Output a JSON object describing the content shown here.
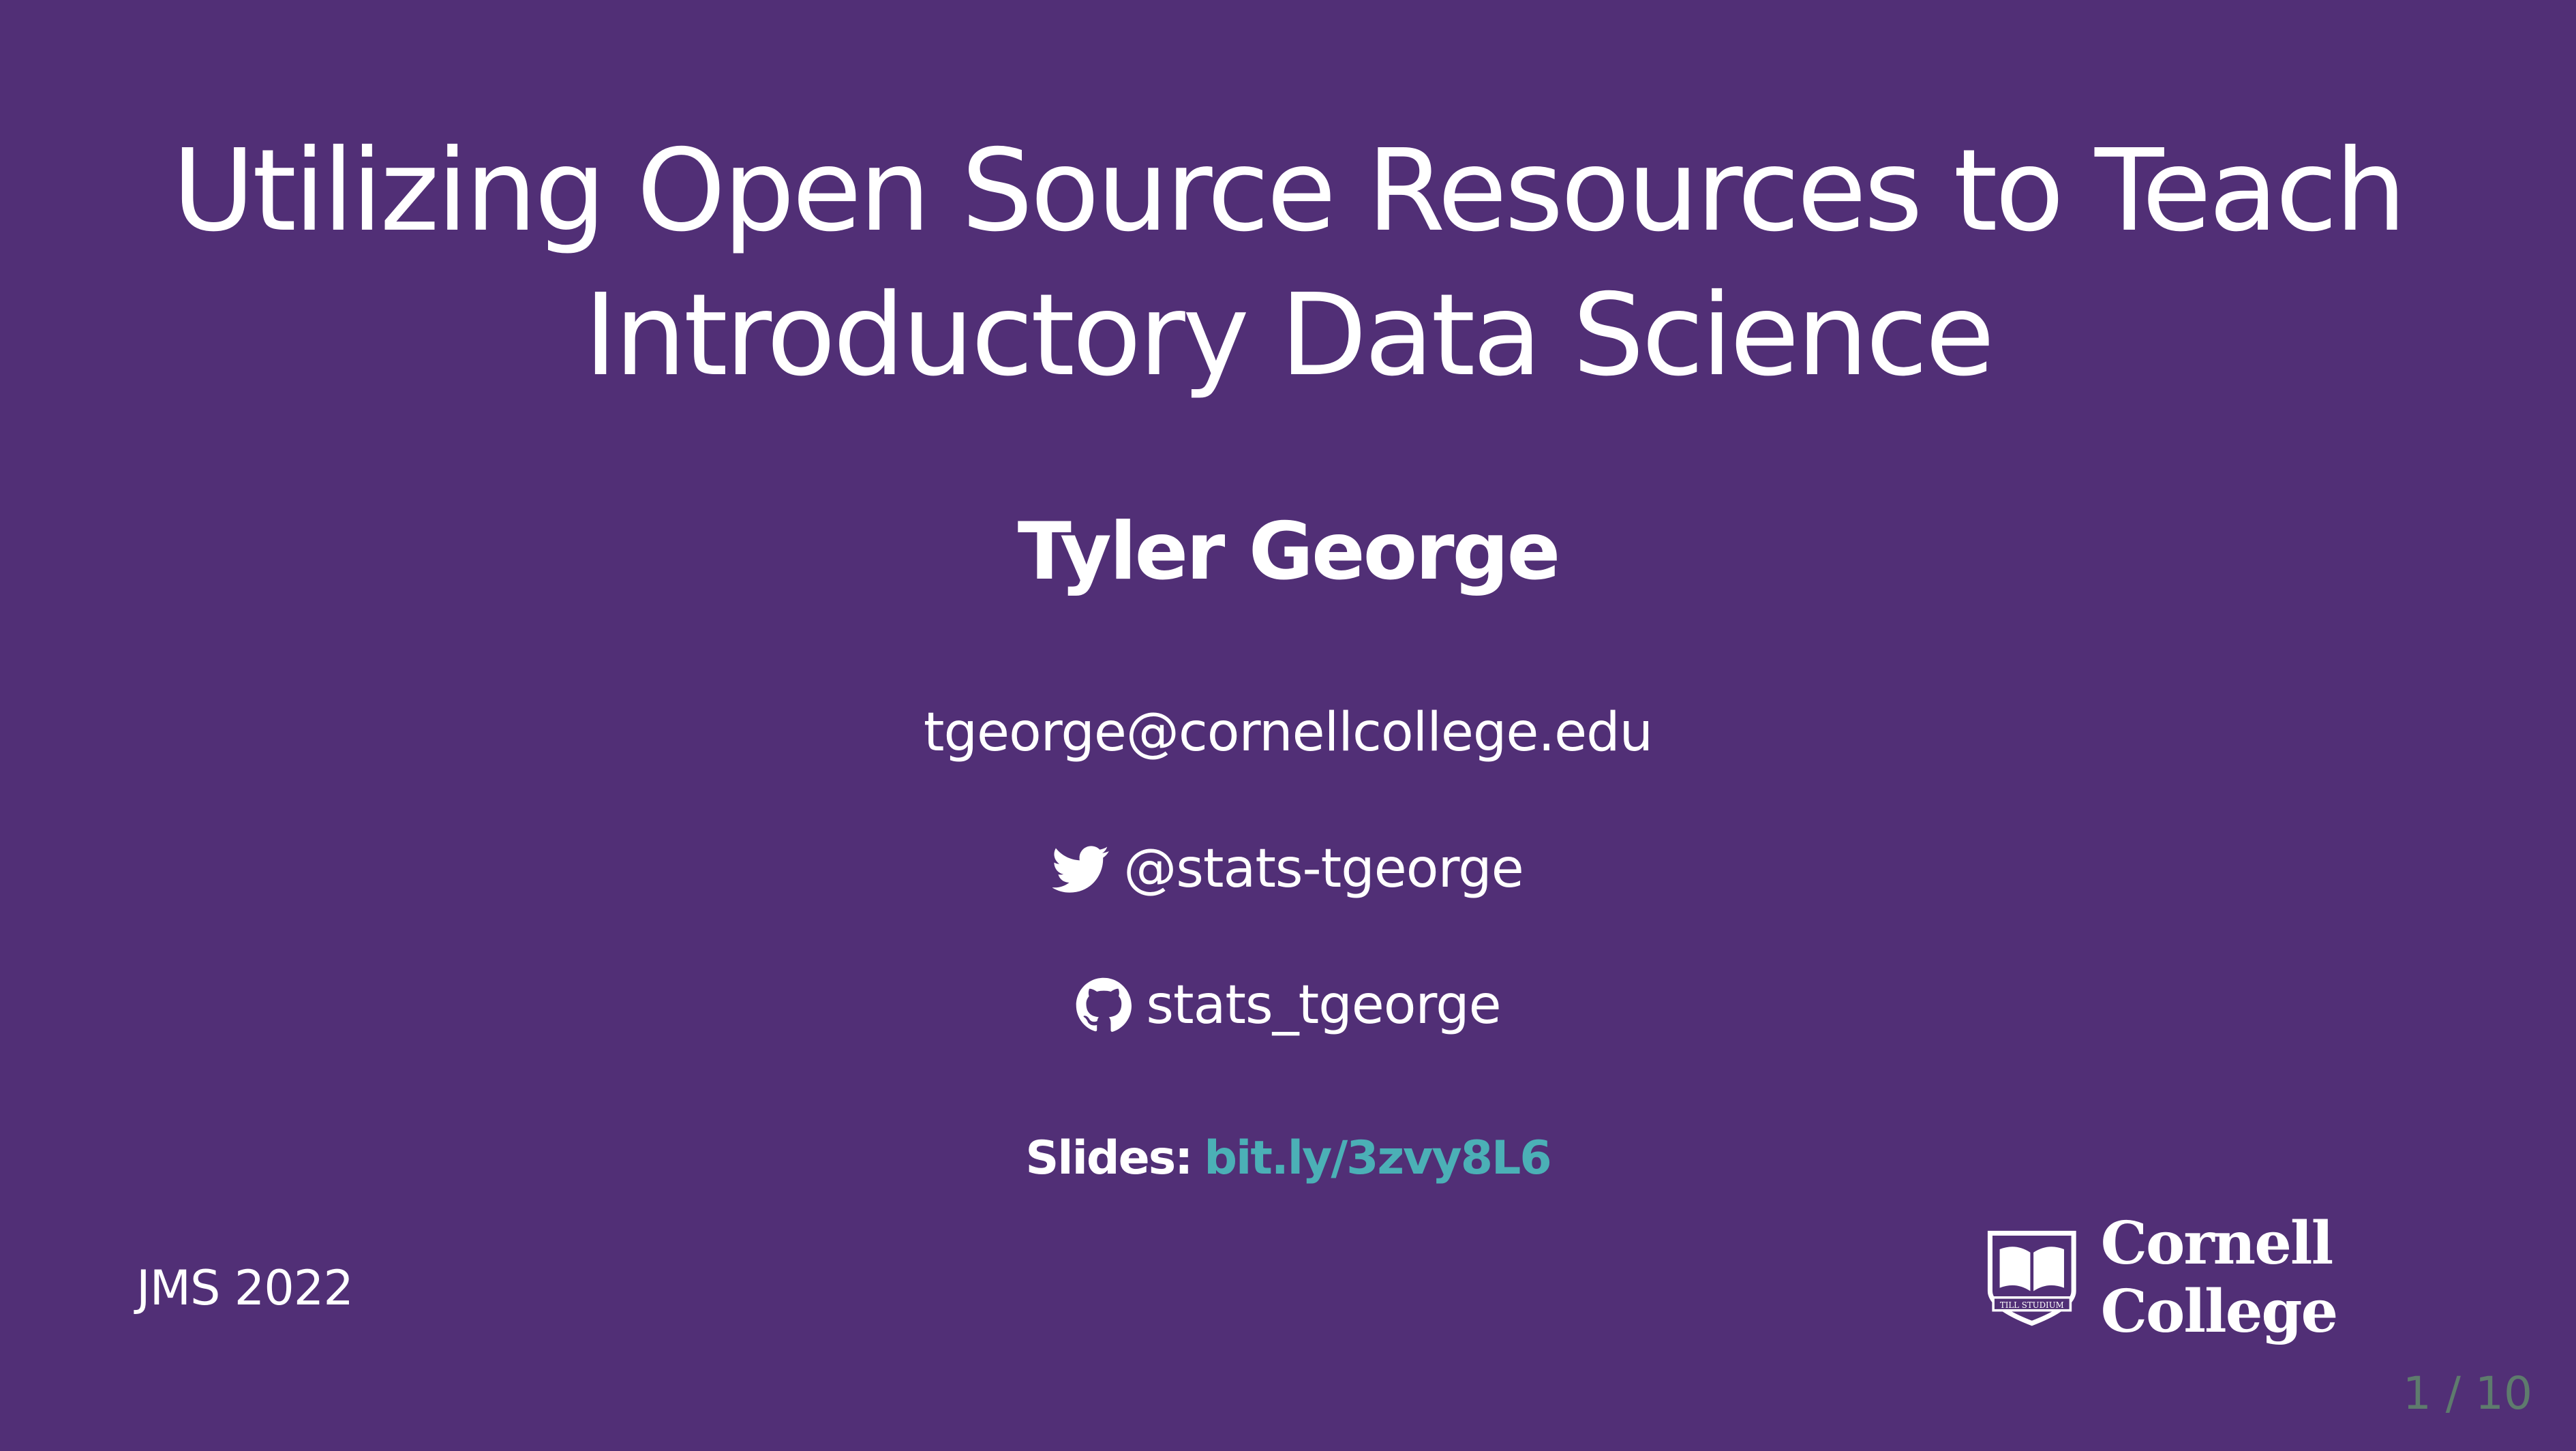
{
  "slide": {
    "title_lines": [
      "Utilizing Open Source Resources to Teach",
      "Introductory Data Science"
    ],
    "author": "Tyler George",
    "email": "tgeorge@cornellcollege.edu",
    "twitter": {
      "icon": "twitter-bird-icon",
      "handle": "@stats-tgeorge"
    },
    "github": {
      "icon": "github-icon",
      "handle": "stats_tgeorge"
    },
    "slides": {
      "label": "Slides:",
      "link_text": "bit.ly/3zvy8L6"
    },
    "footer_left": "JMS 2022",
    "logo": {
      "text": "Cornell College",
      "seal_text": "TILL STUDIUM"
    },
    "page_number": "1 / 10"
  },
  "colors": {
    "background": "#512f76",
    "text": "#ffffff",
    "link": "#4bb0b6",
    "page_number": "#5e7b6d"
  }
}
